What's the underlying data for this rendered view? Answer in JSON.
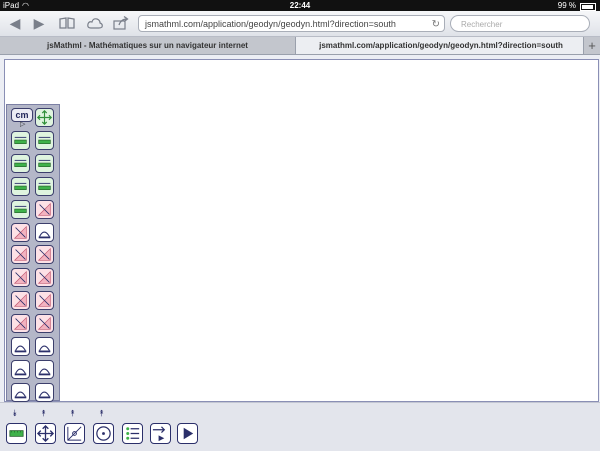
{
  "status_bar": {
    "device": "iPad",
    "time": "22:44",
    "battery": "99 %"
  },
  "browser": {
    "url": "jsmathml.com/application/geodyn/geodyn.html?direction=south",
    "search_placeholder": "Rechercher",
    "tabs": [
      {
        "label": "jsMathml - Mathématiques sur un navigateur internet",
        "active": false
      },
      {
        "label": "jsmathml.com/application/geodyn/geodyn.html?direction=south",
        "active": true
      }
    ]
  },
  "palette": {
    "unit_label": "cm",
    "tools": [
      {
        "name": "move-tool",
        "color": "green"
      },
      {
        "name": "segment-length-tool",
        "color": "green"
      },
      {
        "name": "line-pencil-tool",
        "color": "green"
      },
      {
        "name": "ray-tool",
        "color": "green"
      },
      {
        "name": "line-through-tool",
        "color": "green"
      },
      {
        "name": "segment-arrow-tool",
        "color": "green"
      },
      {
        "name": "line-measure-tool",
        "color": "green"
      },
      {
        "name": "short-segment-tool",
        "color": "green"
      },
      {
        "name": "triangle-tool",
        "color": "pink"
      },
      {
        "name": "triangle-point-tool",
        "color": "pink"
      },
      {
        "name": "diagonal-measure-tool",
        "color": "white"
      },
      {
        "name": "kite-tool",
        "color": "pink"
      },
      {
        "name": "angle-tool",
        "color": "pink"
      },
      {
        "name": "diagonal-a-tool",
        "color": "pink"
      },
      {
        "name": "diagonal-b-tool",
        "color": "pink"
      },
      {
        "name": "corner-tool",
        "color": "pink"
      },
      {
        "name": "vertical-segment-tool",
        "color": "pink"
      },
      {
        "name": "vertical-move-tool",
        "color": "pink"
      },
      {
        "name": "corner-arrow-tool",
        "color": "pink"
      },
      {
        "name": "arc-tool",
        "color": "white"
      },
      {
        "name": "semicircle-tool",
        "color": "white"
      },
      {
        "name": "half-disc-tool",
        "color": "white"
      },
      {
        "name": "pie-tool",
        "color": "white"
      },
      {
        "name": "protractor-tool",
        "color": "white"
      },
      {
        "name": "protractor-2-tool",
        "color": "white"
      }
    ]
  },
  "bottom_bar": {
    "buttons": [
      "ruler-button",
      "move-button",
      "coordinate-button",
      "circle-button",
      "list-button",
      "insert-button",
      "play-button"
    ]
  }
}
